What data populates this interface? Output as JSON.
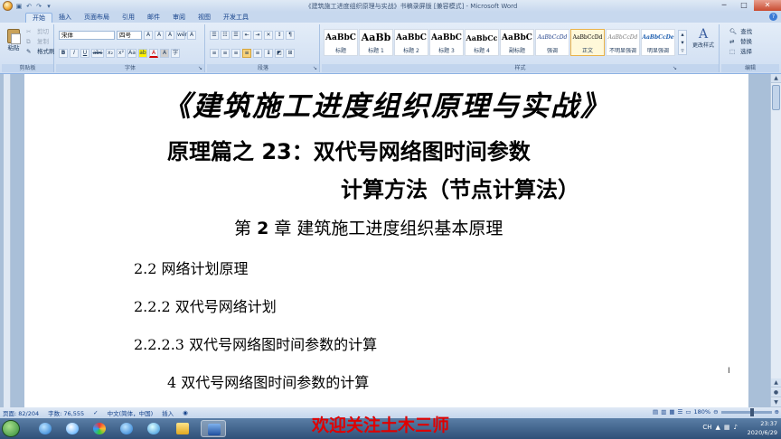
{
  "window": {
    "title": "《建筑施工进度组织原理与实战》书稿录屏版 [兼容模式] - Microsoft Word",
    "qat_icons": [
      "save-icon",
      "undo-icon",
      "redo-icon",
      "customize-icon"
    ],
    "controls": {
      "minimize": "─",
      "maximize": "□",
      "close": "✕"
    }
  },
  "tabs": [
    {
      "label": "开始",
      "active": true
    },
    {
      "label": "插入"
    },
    {
      "label": "页面布局"
    },
    {
      "label": "引用"
    },
    {
      "label": "邮件"
    },
    {
      "label": "审阅"
    },
    {
      "label": "视图"
    },
    {
      "label": "开发工具"
    }
  ],
  "ribbon": {
    "clipboard": {
      "label": "剪贴板",
      "paste": "粘贴",
      "cut": "剪切",
      "copy": "复制",
      "format_painter": "格式刷"
    },
    "font": {
      "label": "字体",
      "font_name": "宋体",
      "font_size": "四号",
      "bold": "B",
      "italic": "I",
      "underline": "U",
      "strike": "abc",
      "subscript": "x₂",
      "superscript": "x²",
      "change_case": "Aa",
      "clear": "A",
      "grow": "A",
      "shrink": "A",
      "phonetic": "wén",
      "border": "A",
      "highlight": "ab",
      "color": "A",
      "shade": "A",
      "enclose": "字"
    },
    "paragraph": {
      "label": "段落"
    },
    "styles": {
      "label": "样式",
      "items": [
        {
          "sample": "AaBbC",
          "name": "标题"
        },
        {
          "sample": "AaBb",
          "name": "标题 1"
        },
        {
          "sample": "AaBbC",
          "name": "标题 2"
        },
        {
          "sample": "AaBbC",
          "name": "标题 3"
        },
        {
          "sample": "AaBbCc",
          "name": "标题 4"
        },
        {
          "sample": "AaBbC",
          "name": "副标题"
        },
        {
          "sample": "AaBbCcDd",
          "name": "强调"
        },
        {
          "sample": "AaBbCcDd",
          "name": "正文",
          "selected": true
        },
        {
          "sample": "AaBbCcDd",
          "name": "不明显强调"
        },
        {
          "sample": "AaBbCcDe",
          "name": "明显强调"
        }
      ],
      "change_styles": "更改样式"
    },
    "editing": {
      "label": "编辑",
      "find": "查找",
      "replace": "替换",
      "select": "选择"
    }
  },
  "document": {
    "title": "《建筑施工进度组织原理与实战》",
    "subtitle_line1": "原理篇之 23：双代号网络图时间参数",
    "subtitle_line2": "计算方法（节点计算法）",
    "chapter_prefix": "第",
    "chapter_num": "2",
    "chapter_suffix": "章  建筑施工进度组织基本原理",
    "sections": [
      "2.2 网络计划原理",
      "2.2.2 双代号网络计划",
      "2.2.2.3 双代号网络图时间参数的计算",
      "4 双代号网络图时间参数的计算"
    ]
  },
  "statusbar": {
    "page": "页面: 82/204",
    "words": "字数: 76,555",
    "language": "中文(简体，中国)",
    "mode": "插入",
    "zoom": "180%"
  },
  "taskbar": {
    "banner": "欢迎关注土木三师",
    "time": "23:37",
    "date": "2020/6/29",
    "tray_label": "CH"
  }
}
